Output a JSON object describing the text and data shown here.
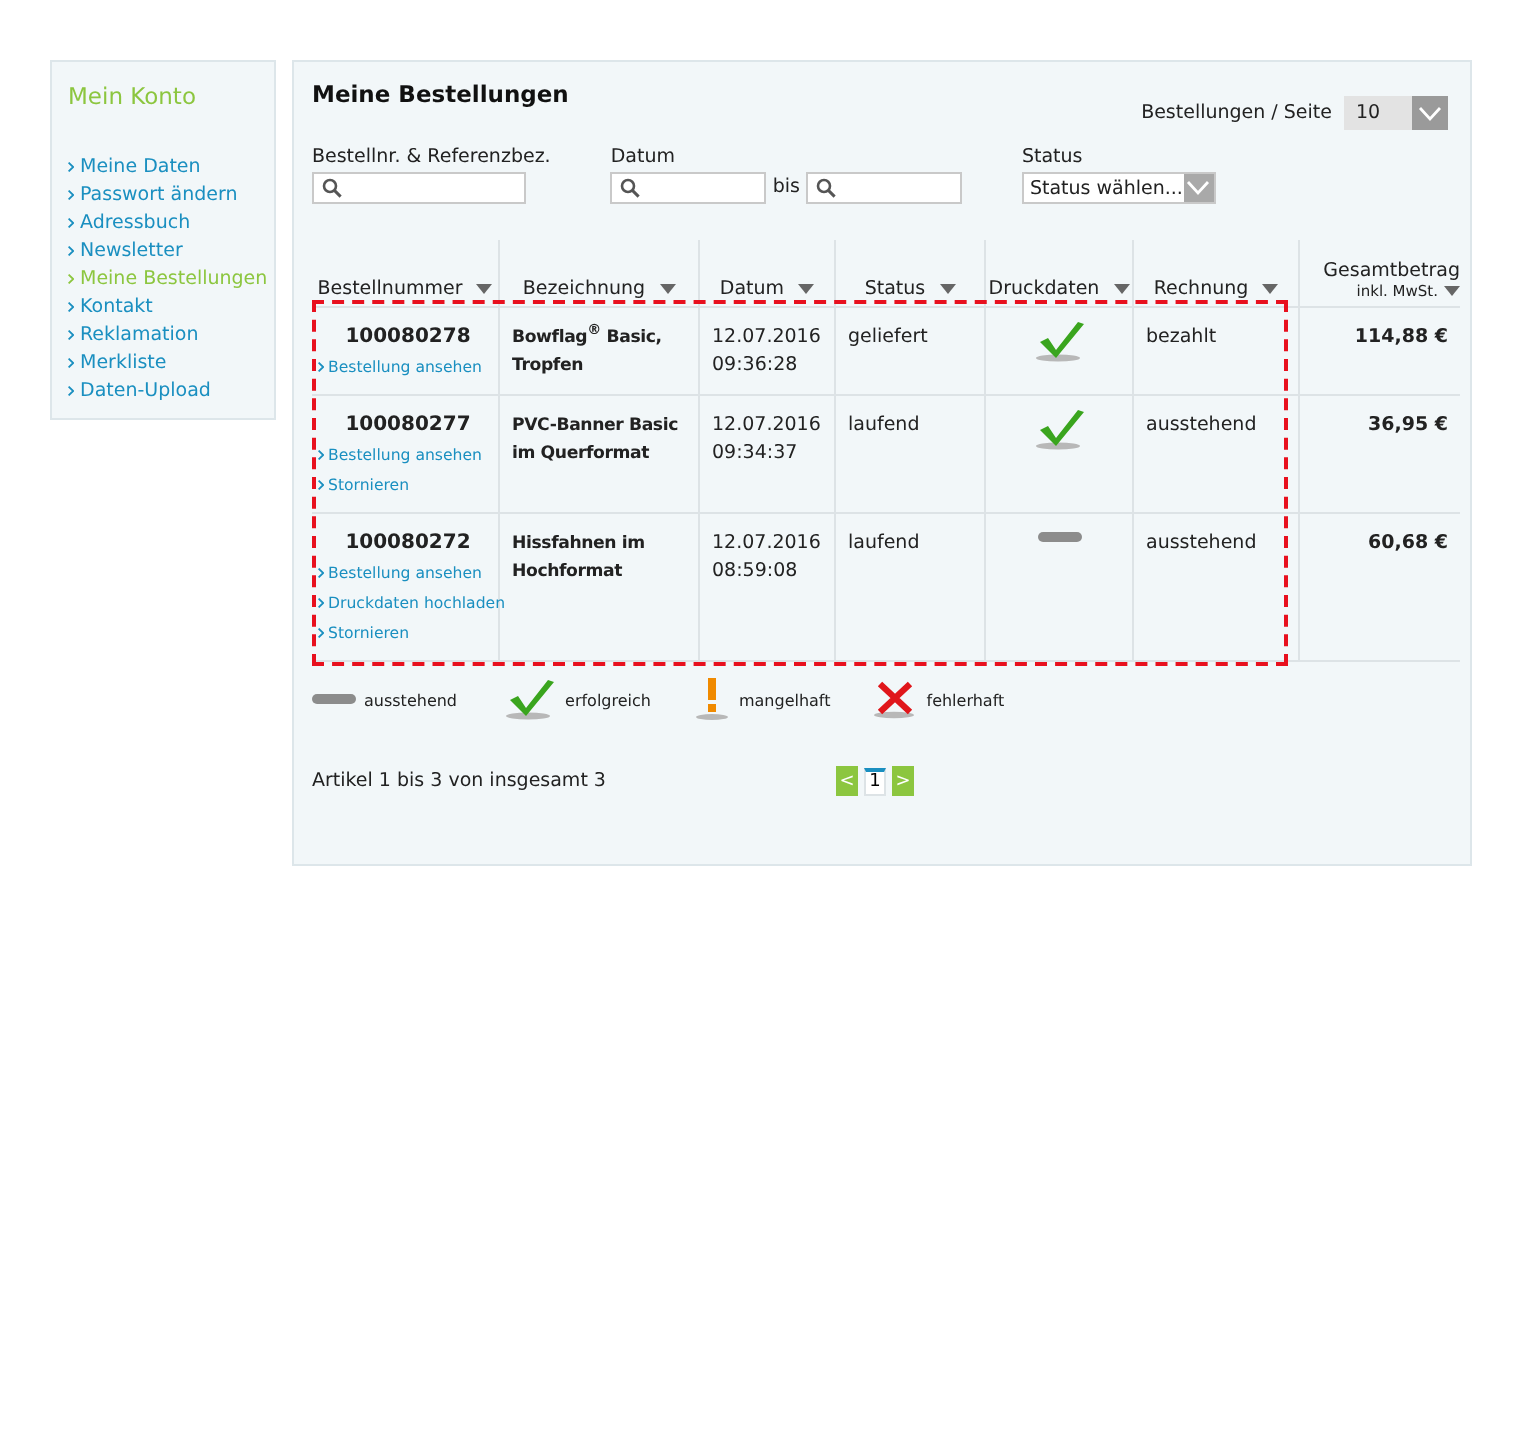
{
  "sidebar": {
    "title": "Mein Konto",
    "items": [
      {
        "label": "Meine Daten",
        "selected": false
      },
      {
        "label": "Passwort ändern",
        "selected": false
      },
      {
        "label": "Adressbuch",
        "selected": false
      },
      {
        "label": "Newsletter",
        "selected": false
      },
      {
        "label": "Meine Bestellungen",
        "selected": true
      },
      {
        "label": "Kontakt",
        "selected": false
      },
      {
        "label": "Reklamation",
        "selected": false
      },
      {
        "label": "Merkliste",
        "selected": false
      },
      {
        "label": "Daten-Upload",
        "selected": false
      }
    ]
  },
  "panel": {
    "title": "Meine Bestellungen",
    "per_page": {
      "label": "Bestellungen / Seite",
      "value": "10"
    },
    "filters": {
      "order": {
        "label": "Bestellnr. & Referenzbez."
      },
      "date": {
        "label": "Datum",
        "separator": "bis"
      },
      "status": {
        "label": "Status",
        "value": "Status wählen..."
      }
    },
    "table": {
      "columns": [
        {
          "label": "Bestellnummer"
        },
        {
          "label": "Bezeichnung"
        },
        {
          "label": "Datum"
        },
        {
          "label": "Status"
        },
        {
          "label": "Druckdaten"
        },
        {
          "label": "Rechnung"
        },
        {
          "label": "Gesamtbetrag",
          "sublabel": "inkl. MwSt."
        }
      ],
      "rows": [
        {
          "order_number": "100080278",
          "links": [
            "Bestellung ansehen"
          ],
          "description": "Bowflag$^{®}$ Basic, Tropfen",
          "date": "12.07.2016",
          "time": "09:36:28",
          "status": "geliefert",
          "print_data": {
            "kind": "success"
          },
          "invoice": "bezahlt",
          "total": "114,88 €"
        },
        {
          "order_number": "100080277",
          "links": [
            "Bestellung ansehen",
            "Stornieren"
          ],
          "description": "PVC-Banner Basic im Querformat",
          "date": "12.07.2016",
          "time": "09:34:37",
          "status": "laufend",
          "print_data": {
            "kind": "success"
          },
          "invoice": "ausstehend",
          "total": "36,95 €"
        },
        {
          "order_number": "100080272",
          "links": [
            "Bestellung ansehen",
            "Druckdaten hochladen",
            "Stornieren"
          ],
          "description": "Hissfahnen im Hochformat",
          "date": "12.07.2016",
          "time": "08:59:08",
          "status": "laufend",
          "print_data": {
            "kind": "pending"
          },
          "invoice": "ausstehend",
          "total": "60,68 €"
        }
      ]
    },
    "legend": [
      {
        "kind": "pending",
        "label": "ausstehend"
      },
      {
        "kind": "success",
        "label": "erfolgreich"
      },
      {
        "kind": "warning",
        "label": "mangelhaft"
      },
      {
        "kind": "error",
        "label": "fehlerhaft"
      }
    ],
    "summary": "Artikel 1 bis 3 von insgesamt 3",
    "pagination": {
      "prev": "<",
      "pages": [
        {
          "label": "1",
          "selected": true
        }
      ],
      "next": ">"
    }
  }
}
